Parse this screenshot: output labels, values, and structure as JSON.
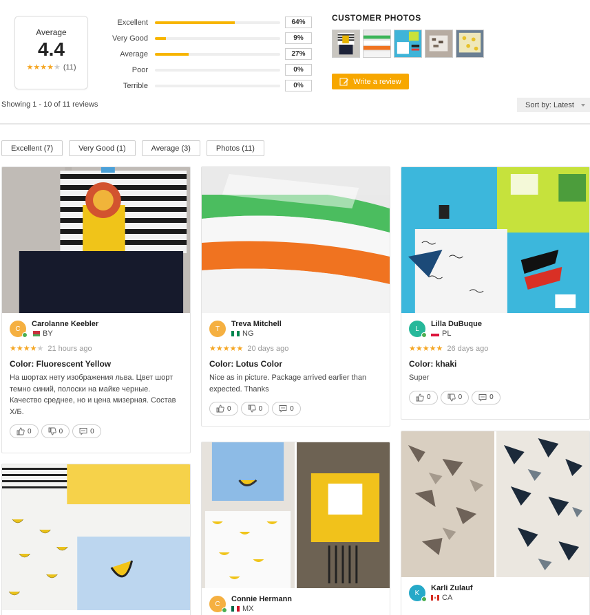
{
  "summary": {
    "average_label": "Average",
    "average_value": "4.4",
    "average_rating": 4.4,
    "review_count": "(11)",
    "distribution": [
      {
        "label": "Excellent",
        "pct": "64%",
        "fraction": 0.64
      },
      {
        "label": "Very Good",
        "pct": "9%",
        "fraction": 0.09
      },
      {
        "label": "Average",
        "pct": "27%",
        "fraction": 0.27
      },
      {
        "label": "Poor",
        "pct": "0%",
        "fraction": 0.0
      },
      {
        "label": "Terrible",
        "pct": "0%",
        "fraction": 0.0
      }
    ]
  },
  "customer_photos": {
    "title": "CUSTOMER PHOTOS",
    "write_review": "Write a review"
  },
  "listing": {
    "showing": "Showing 1 - 10 of 11 reviews",
    "sort": "Sort by: Latest"
  },
  "filters": [
    "Excellent (7)",
    "Very Good (1)",
    "Average (3)",
    "Photos (11)"
  ],
  "reviews": [
    {
      "avatar_letter": "C",
      "avatar_color": "#f5b041",
      "name": "Carolanne Keebler",
      "country": "BY",
      "rating": 4,
      "time": "21 hours ago",
      "color": "Color: Fluorescent Yellow",
      "text": "На шортах нету изображения льва. Цвет шорт темно синий, полоски на майке черные. Качество среднее, но и цена мизерная. Состав Х/Б.",
      "up": "0",
      "down": "0",
      "comments": "0"
    },
    {
      "avatar_letter": "T",
      "avatar_color": "#f5b041",
      "name": "Treva Mitchell",
      "country": "NG",
      "rating": 5,
      "time": "20 days ago",
      "color": "Color: Lotus Color",
      "text": "Nice as in picture. Package arrived earlier than expected. Thanks",
      "up": "0",
      "down": "0",
      "comments": "0"
    },
    {
      "avatar_letter": "L",
      "avatar_color": "#26b89a",
      "name": "Lilla DuBuque",
      "country": "PL",
      "rating": 5,
      "time": "26 days ago",
      "color": "Color: khaki",
      "text": "Super",
      "up": "0",
      "down": "0",
      "comments": "0"
    },
    {
      "avatar_letter": "C",
      "avatar_color": "#f5b041",
      "name": "Connie Hermann",
      "country": "MX"
    },
    {
      "avatar_letter": "K",
      "avatar_color": "#26a9c8",
      "name": "Karli Zulauf",
      "country": "CA"
    }
  ],
  "colors": {
    "accent": "#f7a700",
    "star": "#f5a623",
    "online": "#4caf50"
  }
}
